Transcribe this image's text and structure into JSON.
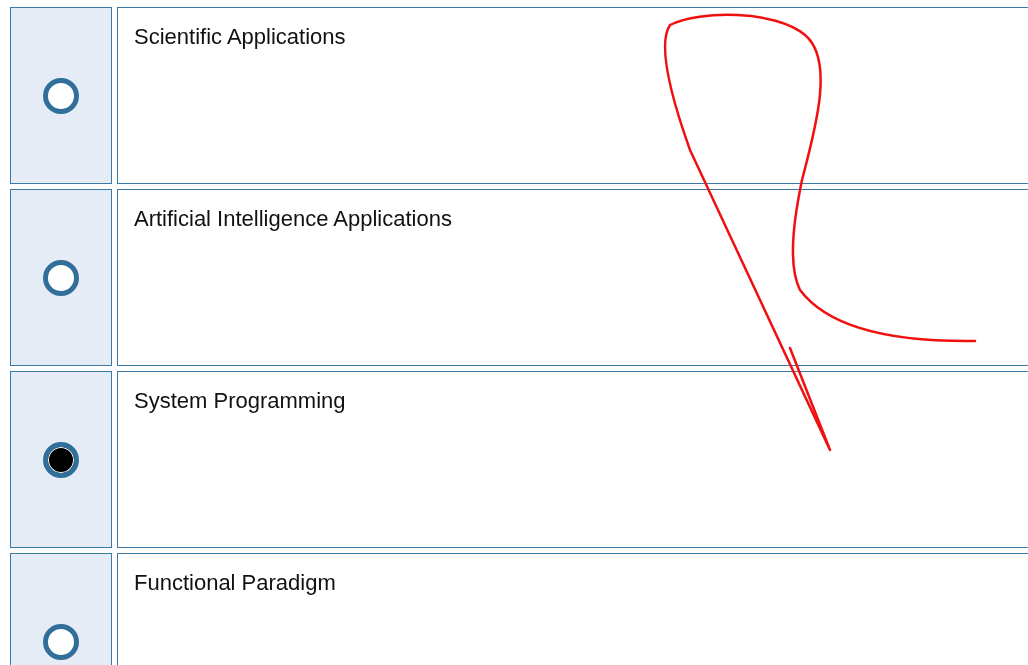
{
  "options": [
    {
      "label": "Scientific Applications",
      "selected": false
    },
    {
      "label": "Artificial Intelligence Applications",
      "selected": false
    },
    {
      "label": "System Programming",
      "selected": true
    },
    {
      "label": "Functional Paradigm",
      "selected": false
    }
  ]
}
